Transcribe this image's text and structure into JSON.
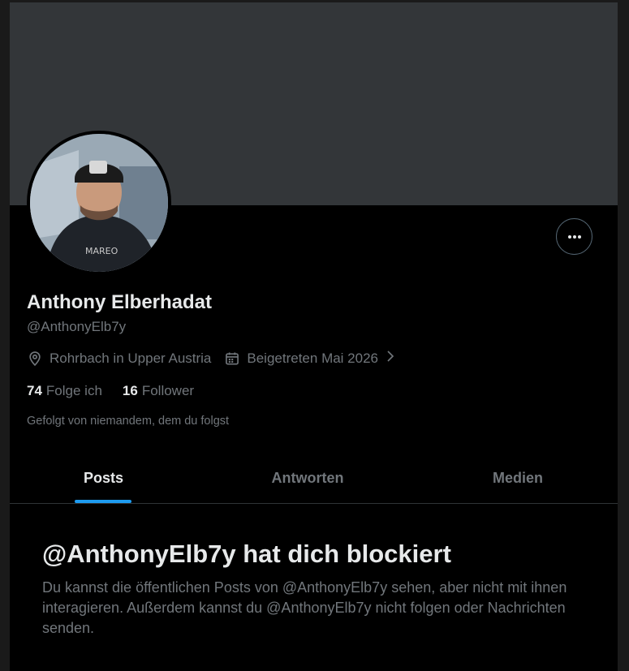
{
  "profile": {
    "name": "Anthony Elberhadat",
    "handle": "@AnthonyElb7y",
    "location": "Rohrbach in Upper Austria",
    "joined": "Beigetreten Mai 2026",
    "following_count": "74",
    "following_label": "Folge ich",
    "followers_count": "16",
    "followers_label": "Follower",
    "followed_by": "Gefolgt von niemandem, dem du folgst"
  },
  "tabs": [
    {
      "label": "Posts",
      "active": true
    },
    {
      "label": "Antworten",
      "active": false
    },
    {
      "label": "Medien",
      "active": false
    }
  ],
  "blocked": {
    "title": "@AnthonyElb7y hat dich blockiert",
    "message": "Du kannst die öffentlichen Posts von @AnthonyElb7y sehen, aber nicht mit ihnen interagieren. Außerdem kannst du @AnthonyElb7y nicht folgen oder Nachrichten senden."
  },
  "icons": {
    "more": "more-horizontal-icon",
    "location": "location-pin-icon",
    "calendar": "calendar-icon",
    "chevron": "chevron-right-icon"
  },
  "colors": {
    "accent": "#1d9bf0",
    "background": "#000000",
    "banner": "#333639",
    "text_primary": "#e7e9ea",
    "text_secondary": "#71767b",
    "border": "#2f3336"
  }
}
